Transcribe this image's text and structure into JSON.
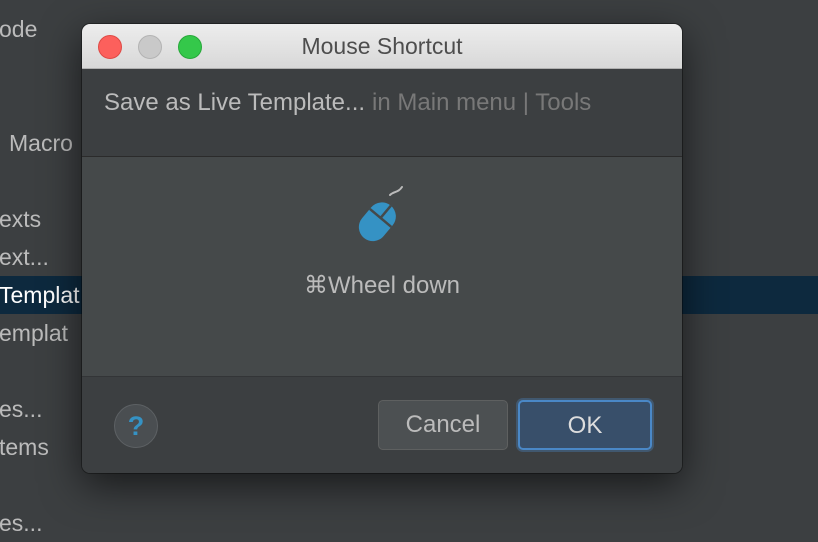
{
  "background_list": {
    "items": [
      {
        "label": "ode",
        "selected": false
      },
      {
        "label": "Macro",
        "selected": false
      },
      {
        "label": "exts",
        "selected": false
      },
      {
        "label": "ext...",
        "selected": false
      },
      {
        "label": "Templat",
        "selected": true
      },
      {
        "label": "emplat",
        "selected": false
      },
      {
        "label": "es...",
        "selected": false
      },
      {
        "label": "tems",
        "selected": false
      },
      {
        "label": "es...",
        "selected": false
      }
    ]
  },
  "dialog": {
    "title": "Mouse Shortcut",
    "window_controls": {
      "close_color": "#fc605c",
      "minimize_color": "#c9c9c9",
      "maximize_color": "#34c84a"
    },
    "action": {
      "name": "Save as Live Template...",
      "path": "in Main menu | Tools"
    },
    "shortcut": {
      "icon": "mouse-icon",
      "text": "⌘Wheel down"
    },
    "footer": {
      "help_icon": "question-mark-icon",
      "help_label": "?",
      "cancel_label": "Cancel",
      "ok_label": "OK"
    }
  },
  "colors": {
    "accent": "#4a88c7",
    "selection": "#0d293e",
    "icon_blue": "#3592c4"
  }
}
